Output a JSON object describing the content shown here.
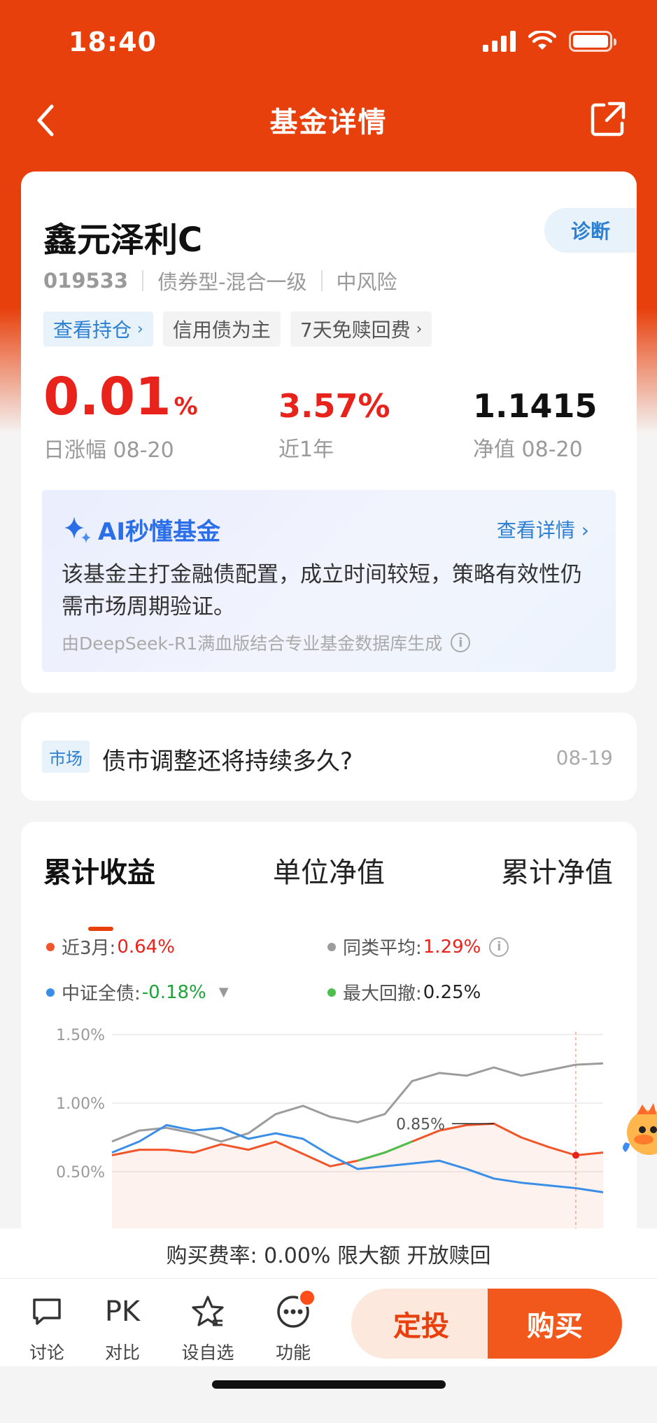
{
  "status_bar": {
    "time": "18:40"
  },
  "nav": {
    "title": "基金详情"
  },
  "fund": {
    "name": "鑫元泽利C",
    "diagnose_label": "诊断",
    "code": "019533",
    "type": "债券型-混合一级",
    "risk": "中风险",
    "tags": [
      {
        "label": "查看持仓",
        "style": "blue",
        "chevron": true
      },
      {
        "label": "信用债为主",
        "style": "gray",
        "chevron": false
      },
      {
        "label": "7天免赎回费",
        "style": "gray",
        "chevron": true
      }
    ],
    "stats": {
      "daily_change_value": "0.01",
      "daily_change_unit": "%",
      "daily_change_label": "日涨幅 08-20",
      "year_return_value": "3.57%",
      "year_return_label": "近1年",
      "nav_value": "1.1415",
      "nav_label": "净值 08-20"
    }
  },
  "ai": {
    "title": "AI秒懂基金",
    "more_label": "查看详情",
    "text": "该基金主打金融债配置，成立时间较短，策略有效性仍需市场周期验证。",
    "source": "由DeepSeek-R1满血版结合专业基金数据库生成"
  },
  "news": {
    "tag": "市场",
    "title": "债市调整还将持续多久?",
    "date": "08-19"
  },
  "chart_tabs": [
    "累计收益",
    "单位净值",
    "累计净值"
  ],
  "legend": {
    "near3m_label": "近3月:",
    "near3m_value": "0.64%",
    "peer_label": "同类平均:",
    "peer_value": "1.29%",
    "index_label": "中证全债:",
    "index_value": "-0.18%",
    "drawdown_label": "最大回撤:",
    "drawdown_value": "0.25%"
  },
  "colors": {
    "accent": "#e8400c",
    "fund_line": "#f0562a",
    "peer_line": "#9c9c9c",
    "index_line": "#3a8ee6",
    "drawdown": "#4cbf4c",
    "up": "#e8231b",
    "down": "#1fa33a"
  },
  "chart_data": {
    "type": "line",
    "yticks": [
      "1.50%",
      "1.00%",
      "0.50%"
    ],
    "ylim": [
      0.5,
      1.5
    ],
    "annotation": "0.85%",
    "series": [
      {
        "name": "近3月",
        "values": [
          0.62,
          0.66,
          0.66,
          0.64,
          0.7,
          0.66,
          0.72,
          0.63,
          0.54,
          0.58,
          0.64,
          0.72,
          0.8,
          0.84,
          0.85,
          0.75,
          0.68,
          0.62,
          0.64
        ]
      },
      {
        "name": "同类平均",
        "values": [
          0.72,
          0.8,
          0.82,
          0.78,
          0.72,
          0.78,
          0.92,
          0.98,
          0.9,
          0.86,
          0.92,
          1.16,
          1.22,
          1.2,
          1.26,
          1.2,
          1.24,
          1.28,
          1.29
        ]
      },
      {
        "name": "中证全债",
        "values": [
          0.64,
          0.72,
          0.84,
          0.8,
          0.82,
          0.74,
          0.78,
          0.74,
          0.62,
          0.52,
          0.54,
          0.56,
          0.58,
          0.52,
          0.45,
          0.42,
          0.4,
          0.38,
          0.35
        ]
      }
    ]
  },
  "fee_text": "购买费率: 0.00% 限大额 开放赎回",
  "bottom": {
    "discuss": "讨论",
    "pk_glyph": "PK",
    "pk": "对比",
    "watch": "设自选",
    "func": "功能",
    "dingtou": "定投",
    "buy": "购买"
  }
}
